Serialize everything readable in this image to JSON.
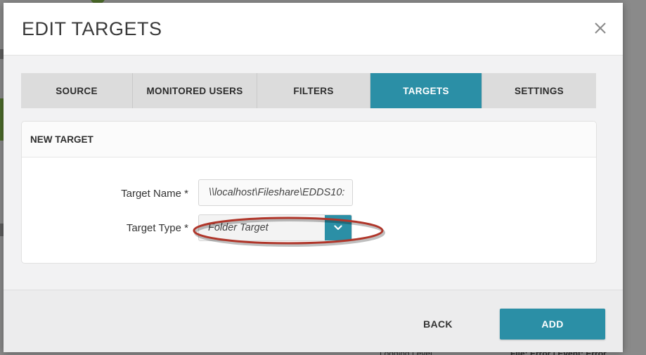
{
  "modal": {
    "title": "EDIT TARGETS"
  },
  "tabs": [
    {
      "label": "SOURCE",
      "active": false
    },
    {
      "label": "MONITORED USERS",
      "active": false
    },
    {
      "label": "FILTERS",
      "active": false
    },
    {
      "label": "TARGETS",
      "active": true
    },
    {
      "label": "SETTINGS",
      "active": false
    }
  ],
  "card": {
    "title": "NEW TARGET",
    "target_name": {
      "label": "Target Name *",
      "value": "\\\\localhost\\Fileshare\\EDDS10:"
    },
    "target_type": {
      "label": "Target Type *",
      "selected": "Folder Target"
    }
  },
  "footer": {
    "back_label": "BACK",
    "add_label": "ADD"
  },
  "background": {
    "bottom_left_text": "Logging Level",
    "bottom_right_text": "File: Error | Event: Error"
  },
  "colors": {
    "accent": "#2b8fa6",
    "annotation": "#b0362a",
    "tab_inactive": "#dcdcdc"
  },
  "icons": {
    "close": "close-icon",
    "dropdown": "chevron-down-icon"
  }
}
